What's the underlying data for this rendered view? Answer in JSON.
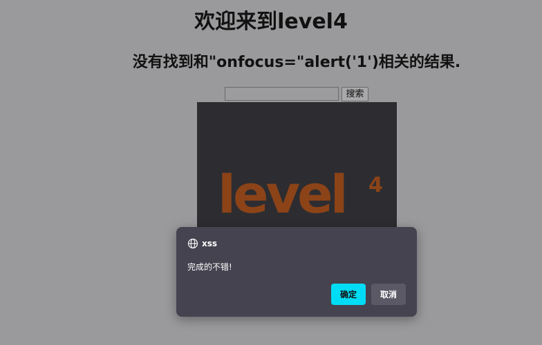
{
  "page": {
    "title": "欢迎来到level4",
    "result_message": "没有找到和\"onfocus=\"alert('1')相关的结果."
  },
  "search": {
    "input_value": "",
    "button_label": "搜索"
  },
  "image": {
    "logo_text": "level",
    "logo_superscript": "4",
    "logo_color": "#8c4318",
    "background_color": "#2d2d31"
  },
  "dialog": {
    "site": "xss",
    "icon": "globe-icon",
    "message": "完成的不错!",
    "ok_label": "确定",
    "cancel_label": "取消",
    "accent_color": "#00dcf5"
  }
}
